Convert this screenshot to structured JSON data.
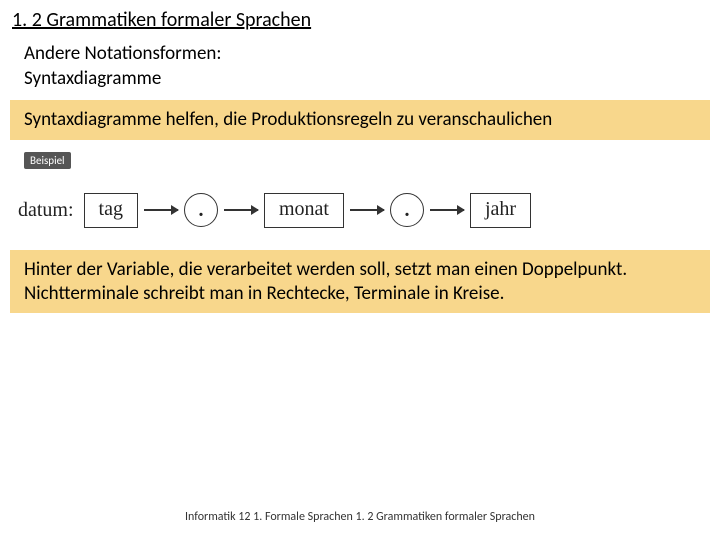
{
  "title": "1. 2 Grammatiken formaler Sprachen",
  "subtitle_line1": "Andere Notationsformen:",
  "subtitle_line2": "Syntaxdiagramme",
  "box1": "Syntaxdiagramme helfen, die Produktionsregeln zu veranschaulichen",
  "badge": "Beispiel",
  "diagram": {
    "label": "datum:",
    "nodes": [
      "tag",
      ".",
      "monat",
      ".",
      "jahr"
    ]
  },
  "box2_line1": "Hinter der Variable, die verarbeitet werden soll, setzt man einen Doppelpunkt.",
  "box2_line2": "Nichtterminale schreibt man in Rechtecke, Terminale in Kreise.",
  "footer": "Informatik 12 1. Formale Sprachen 1. 2 Grammatiken formaler Sprachen"
}
